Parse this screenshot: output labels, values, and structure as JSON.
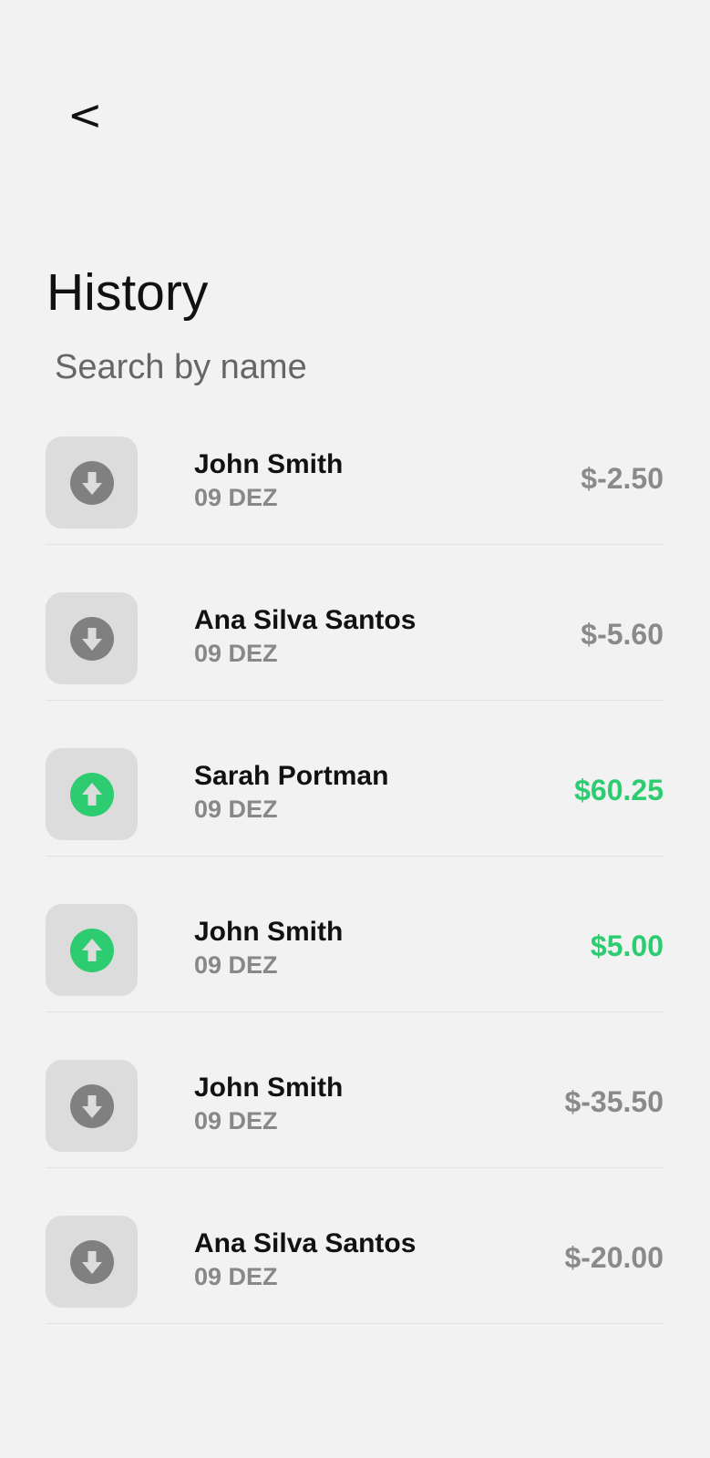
{
  "header": {
    "back_label": "<"
  },
  "title": "History",
  "search": {
    "placeholder": "Search by name",
    "value": ""
  },
  "colors": {
    "background": "#f2f2f2",
    "incoming": "#2ecc71",
    "outgoing": "#808080",
    "icon_box": "#dcdcdc"
  },
  "transactions": [
    {
      "name": "John Smith",
      "date": "09 DEZ",
      "amount": "$-2.50",
      "direction": "out",
      "icon": "arrow-down-circle-icon"
    },
    {
      "name": "Ana Silva Santos",
      "date": "09 DEZ",
      "amount": "$-5.60",
      "direction": "out",
      "icon": "arrow-down-circle-icon"
    },
    {
      "name": "Sarah Portman",
      "date": "09 DEZ",
      "amount": "$60.25",
      "direction": "in",
      "icon": "arrow-up-circle-icon"
    },
    {
      "name": "John Smith",
      "date": "09 DEZ",
      "amount": "$5.00",
      "direction": "in",
      "icon": "arrow-up-circle-icon"
    },
    {
      "name": "John Smith",
      "date": "09 DEZ",
      "amount": "$-35.50",
      "direction": "out",
      "icon": "arrow-down-circle-icon"
    },
    {
      "name": "Ana Silva Santos",
      "date": "09 DEZ",
      "amount": "$-20.00",
      "direction": "out",
      "icon": "arrow-down-circle-icon"
    }
  ]
}
